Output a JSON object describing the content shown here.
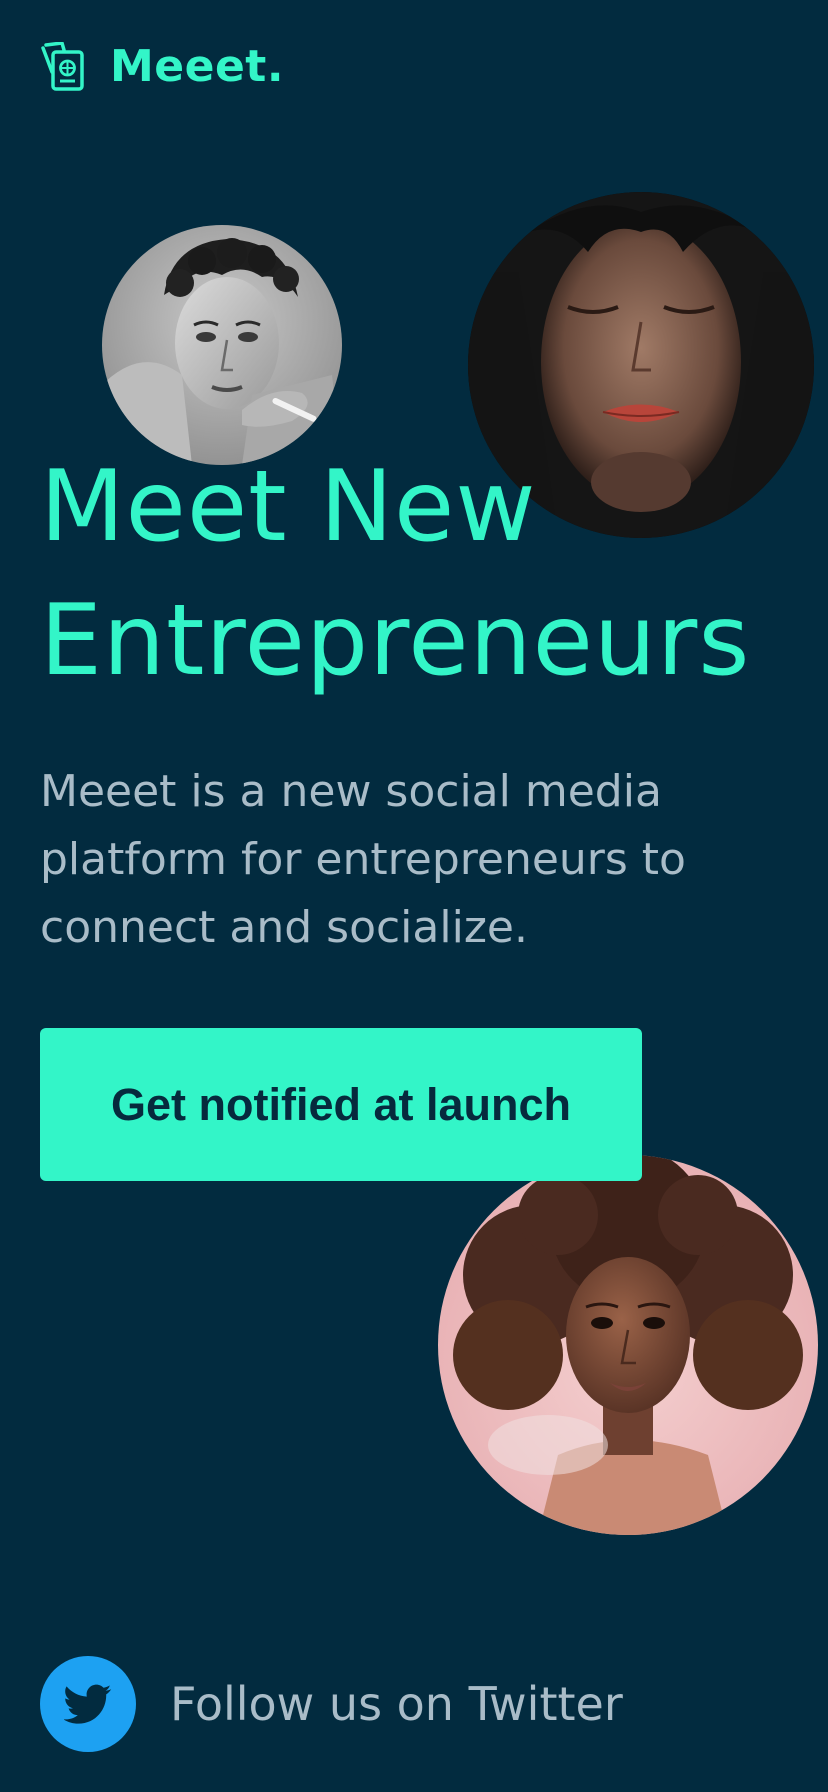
{
  "brand": {
    "name": "Meeet.",
    "logo_icon": "passport-icon",
    "accent_color": "#33F5C8",
    "background_color": "#022B3F"
  },
  "hero": {
    "headline_line1": "Meet New",
    "headline_line2": "Entrepreneurs",
    "description": "Meeet is a new social media platform for entrepreneurs to connect and socialize.",
    "cta_label": "Get notified at launch"
  },
  "footer": {
    "twitter_label": "Follow us on Twitter",
    "twitter_icon": "twitter-bird-icon",
    "twitter_color": "#1DA1F2"
  }
}
